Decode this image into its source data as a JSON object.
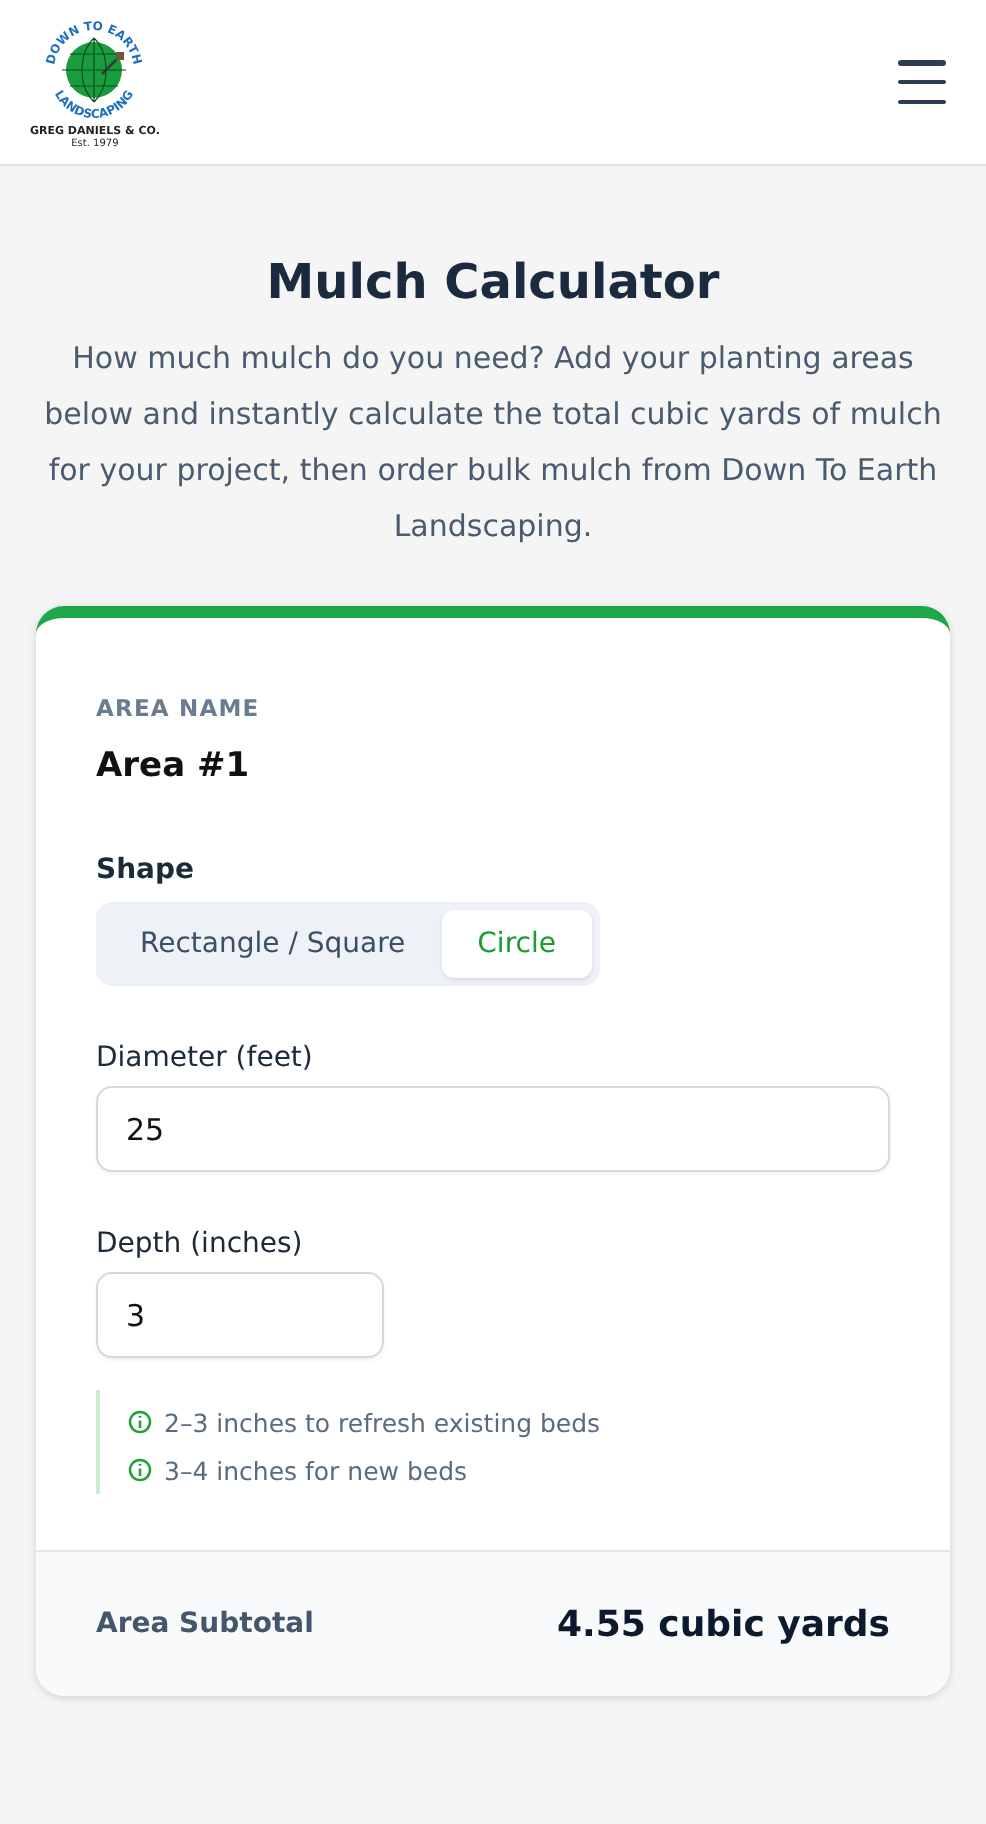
{
  "header": {
    "logo": {
      "arc_top": "DOWN TO EARTH",
      "arc_bottom": "LANDSCAPING",
      "company": "GREG DANIELS & CO.",
      "established": "Est. 1979"
    }
  },
  "intro": {
    "title": "Mulch Calculator",
    "description": "How much mulch do you need? Add your planting areas below and instantly calculate the total cubic yards of mulch for your project, then order bulk mulch from Down To Earth Landscaping."
  },
  "area": {
    "name_label": "AREA NAME",
    "name": "Area #1",
    "shape_label": "Shape",
    "shapes": [
      {
        "label": "Rectangle / Square",
        "selected": false
      },
      {
        "label": "Circle",
        "selected": true
      }
    ],
    "diameter": {
      "label": "Diameter (feet)",
      "value": "25"
    },
    "depth": {
      "label": "Depth (inches)",
      "value": "3"
    },
    "tips": [
      "2–3 inches to refresh existing beds",
      "3–4 inches for new beds"
    ],
    "subtotal": {
      "label": "Area Subtotal",
      "value": "4.55 cubic yards"
    }
  }
}
